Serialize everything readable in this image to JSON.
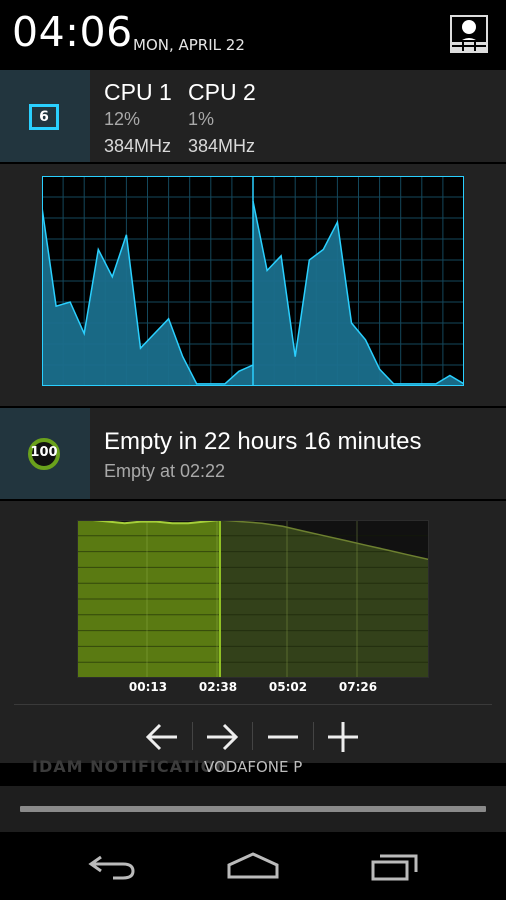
{
  "status": {
    "time": "04:06",
    "date": "MON, APRIL 22"
  },
  "cpu": {
    "icon_number": "6",
    "cores": [
      {
        "label": "CPU 1",
        "percent": "12%",
        "freq": "384MHz"
      },
      {
        "label": "CPU 2",
        "percent": "1%",
        "freq": "384MHz"
      }
    ]
  },
  "battery": {
    "level": "100",
    "title": "Empty in 22 hours 16 minutes",
    "subtitle": "Empty at 02:22",
    "axis_ticks": [
      "00:13",
      "02:38",
      "05:02",
      "07:26"
    ]
  },
  "behind_notification": {
    "left_text": "IDAM NOTIFICATION",
    "right_text": "VODAFONE P"
  },
  "colors": {
    "cpu_accent": "#2ad0ff",
    "cpu_fill": "#1a6f8c",
    "battery_fill": "#5a7a12",
    "battery_ring": "#6aa11c"
  },
  "chart_data": [
    {
      "type": "area",
      "name_hint": "cpu-1-history",
      "x": [
        0,
        1,
        2,
        3,
        4,
        5,
        6,
        7,
        8,
        9,
        10,
        11,
        12,
        13,
        14,
        15
      ],
      "values": [
        85,
        38,
        40,
        25,
        65,
        52,
        72,
        18,
        25,
        32,
        14,
        1,
        1,
        1,
        7,
        10
      ],
      "ylim": [
        0,
        100
      ],
      "grid": true
    },
    {
      "type": "area",
      "name_hint": "cpu-2-history",
      "x": [
        0,
        1,
        2,
        3,
        4,
        5,
        6,
        7,
        8,
        9,
        10,
        11,
        12,
        13,
        14,
        15
      ],
      "values": [
        88,
        55,
        62,
        14,
        60,
        65,
        78,
        30,
        22,
        8,
        1,
        1,
        1,
        1,
        5,
        1
      ],
      "ylim": [
        0,
        100
      ],
      "grid": true
    },
    {
      "type": "area",
      "name_hint": "battery-history",
      "x_ticks": [
        "00:13",
        "02:38",
        "05:02",
        "07:26"
      ],
      "history": [
        100,
        100,
        99,
        98,
        99,
        99,
        98,
        98,
        99,
        100
      ],
      "forecast": [
        100,
        99,
        98,
        96,
        93,
        90,
        87,
        84,
        81,
        78,
        75
      ],
      "ylim": [
        0,
        100
      ],
      "grid": true
    }
  ]
}
